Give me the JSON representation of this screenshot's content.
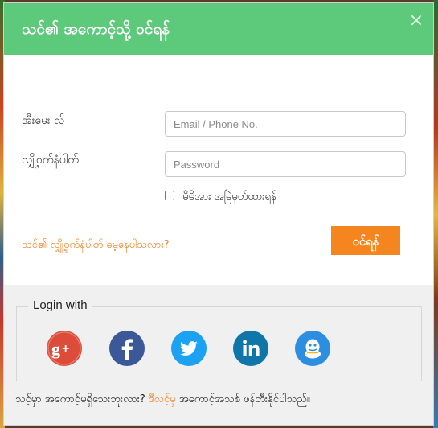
{
  "modal": {
    "title": "သင်၏ အကောင့်သို့ ဝင်ရန်",
    "close_glyph": "×"
  },
  "form": {
    "email_label": "အီးမေး လ်",
    "email_placeholder": "Email / Phone No.",
    "email_value": "",
    "password_label": "လျှို့ဝှက်နံပါတ်",
    "password_placeholder": "Password",
    "password_value": "",
    "remember_label": "မိမိအား အမြဲမှတ်ထားရန်",
    "remember_checked": false,
    "forgot_link": "သင်၏ လျှို့ဝှက်နံပါတ် မေ့နေပါသလား?",
    "login_button": "ဝင်ရန်"
  },
  "social": {
    "legend": "Login with",
    "providers": [
      {
        "name": "google-plus",
        "icon": "google-plus-icon",
        "color": "#dd4b39"
      },
      {
        "name": "facebook",
        "icon": "facebook-icon",
        "color": "#3b5998"
      },
      {
        "name": "twitter",
        "icon": "twitter-icon",
        "color": "#1da1f2"
      },
      {
        "name": "linkedin",
        "icon": "linkedin-icon",
        "color": "#0e76a8"
      },
      {
        "name": "qq",
        "icon": "qq-icon",
        "color": "#2b8ee0"
      }
    ]
  },
  "footer": {
    "text_before": "သင့်မှာ အကောင့်မရှိသေးဘူးလား?",
    "register_link": "ဒီလင့်မှ",
    "text_after": "အကောင့်အသစ် ဖန်တီးနိုင်ပါသည်။"
  },
  "colors": {
    "header": "#5dc97a",
    "accent": "#f5861f",
    "link": "#f07f1c"
  }
}
